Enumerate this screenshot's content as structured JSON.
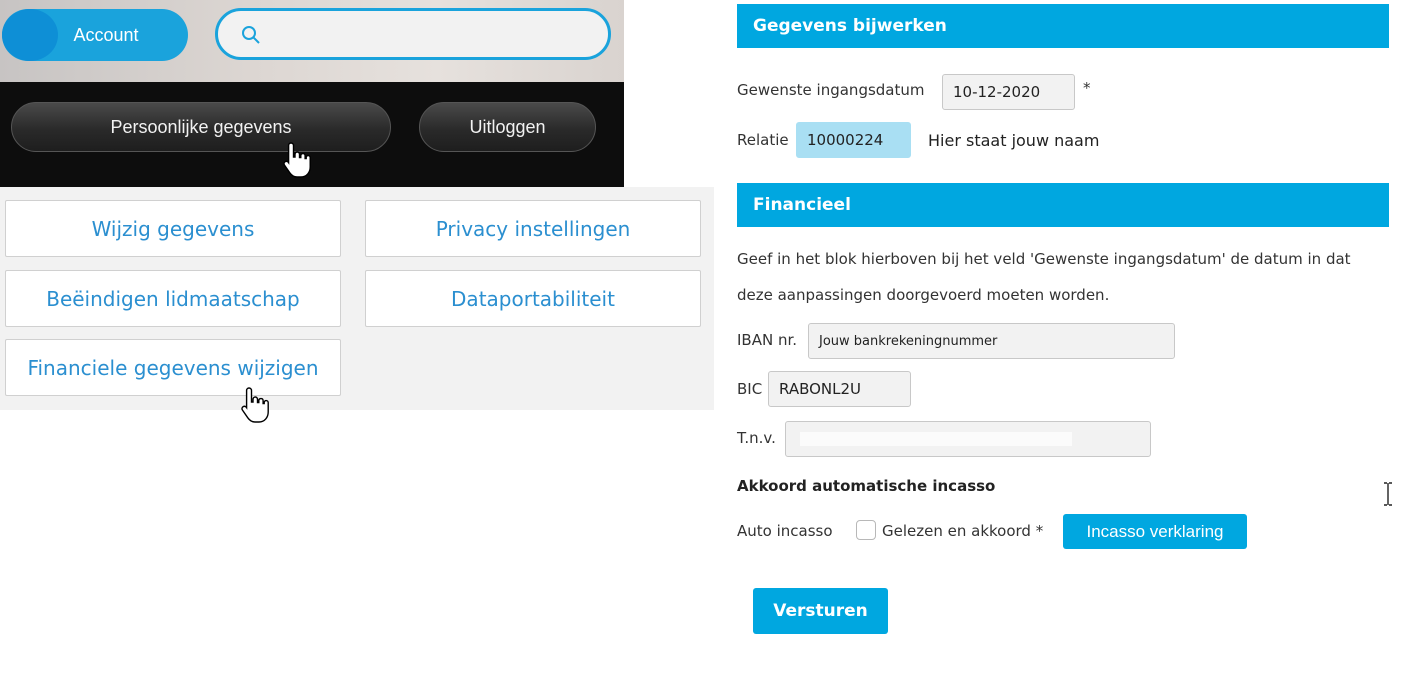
{
  "header": {
    "account_label": "Account",
    "search_placeholder": ""
  },
  "nav": {
    "personal_data_label": "Persoonlijke gegevens",
    "logout_label": "Uitloggen"
  },
  "tiles": {
    "change_data": "Wijzig gegevens",
    "privacy_settings": "Privacy instellingen",
    "end_membership": "Beëindigen lidmaatschap",
    "data_portability": "Dataportabiliteit",
    "change_financial": "Financiele gegevens wijzigen"
  },
  "update_section": {
    "title": "Gegevens bijwerken",
    "start_date_label": "Gewenste ingangsdatum",
    "start_date_value": "10-12-2020",
    "required_mark": "*",
    "relation_label": "Relatie",
    "relation_value": "10000224",
    "relation_name": "Hier staat jouw naam"
  },
  "financial_section": {
    "title": "Financieel",
    "info_line1": "Geef in het blok hierboven bij het veld 'Gewenste ingangsdatum' de datum in dat",
    "info_line2": "deze aanpassingen doorgevoerd moeten worden.",
    "iban_label": "IBAN nr.",
    "iban_value": "Jouw bankrekeningnummer",
    "bic_label": "BIC",
    "bic_value": "RABONL2U",
    "tnv_label": "T.n.v.",
    "tnv_value": "",
    "direct_debit_heading": "Akkoord automatische incasso",
    "auto_debit_label": "Auto incasso",
    "read_agree_label": "Gelezen en akkoord *",
    "debit_statement_button": "Incasso verklaring",
    "submit_button": "Versturen"
  },
  "colors": {
    "accent": "#00a7e0",
    "tile_text": "#2b8fd0",
    "dark_bar": "#0d0d0d"
  },
  "icons": [
    "search-icon",
    "hand-pointer-icon",
    "text-cursor-icon"
  ]
}
